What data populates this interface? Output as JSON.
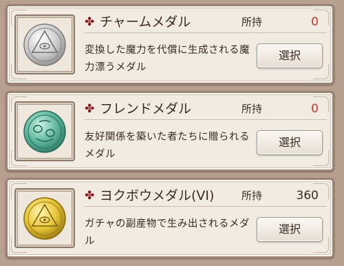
{
  "owned_label": "所持",
  "select_label": "選択",
  "medals": [
    {
      "name": "チャームメダル",
      "owned": "0",
      "description": "変換した魔力を代償に生成される魔力漂うメダル",
      "medal_color": "silver",
      "count_color": "#c0392b"
    },
    {
      "name": "フレンドメダル",
      "owned": "0",
      "description": "友好関係を築いた者たちに贈られるメダル",
      "medal_color": "teal",
      "count_color": "#c0392b"
    },
    {
      "name": "ヨクボウメダル(VI)",
      "owned": "360",
      "description": "ガチャの副産物で生み出されるメダル",
      "medal_color": "gold",
      "count_color": "#3b2b22"
    }
  ]
}
